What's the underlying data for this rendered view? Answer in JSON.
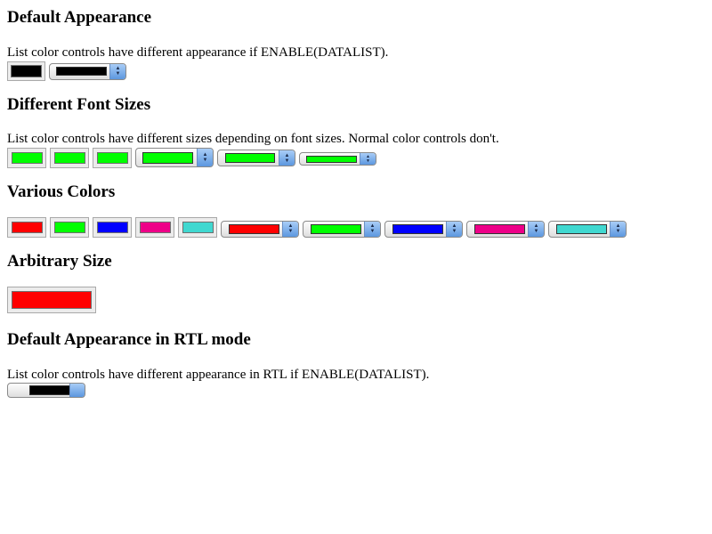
{
  "sections": {
    "default": {
      "title": "Default Appearance",
      "description": "List color controls have different appearance if ENABLE(DATALIST).",
      "color": "#000000"
    },
    "font_sizes": {
      "title": "Different Font Sizes",
      "description": "List color controls have different sizes depending on font sizes. Normal color controls don't.",
      "color": "#00ff00"
    },
    "various": {
      "title": "Various Colors",
      "colors": [
        "#ff0000",
        "#00ff00",
        "#0000ff",
        "#ee0088",
        "#40d8d0"
      ]
    },
    "arbitrary": {
      "title": "Arbitrary Size",
      "color": "#ff0000"
    },
    "rtl": {
      "title": "Default Appearance in RTL mode",
      "description": "List color controls have different appearance in RTL if ENABLE(DATALIST).",
      "color": "#000000"
    }
  },
  "icons": {
    "dropdown_arrow": "up-down-chevron-icon"
  }
}
